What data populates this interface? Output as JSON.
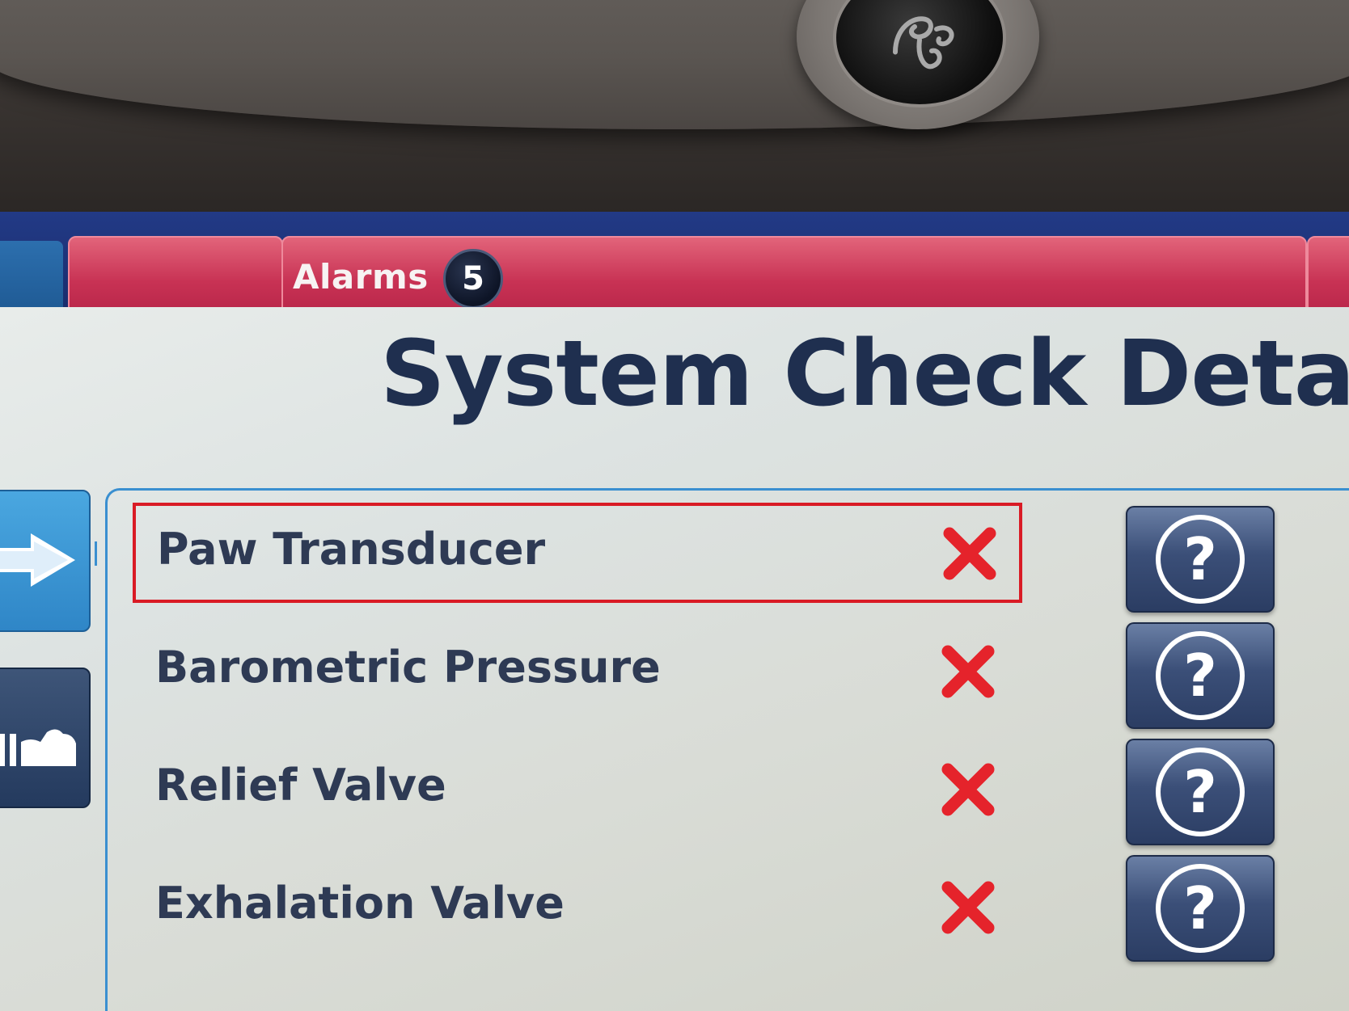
{
  "device": {
    "logo_icon": "ge-logo-icon"
  },
  "header": {
    "alarms_tab_label": "Alarms",
    "alarm_count": "5"
  },
  "main": {
    "title": "System Check Details",
    "nav_icons": [
      "arrow-right-icon",
      "ventilator-icon"
    ],
    "checks": [
      {
        "label": "Paw Transducer",
        "status_icon": "fail-x-icon",
        "selected": true,
        "help_icon": "question-mark-icon"
      },
      {
        "label": "Barometric Pressure",
        "status_icon": "fail-x-icon",
        "selected": false,
        "help_icon": "question-mark-icon"
      },
      {
        "label": "Relief Valve",
        "status_icon": "fail-x-icon",
        "selected": false,
        "help_icon": "question-mark-icon"
      },
      {
        "label": "Exhalation Valve",
        "status_icon": "fail-x-icon",
        "selected": false,
        "help_icon": "question-mark-icon"
      }
    ],
    "help_symbol": "?"
  },
  "colors": {
    "alarm_tab": "#c83254",
    "topbar": "#1b2f73",
    "fail_x": "#e5232b",
    "selection_border": "#d91b25",
    "title_text": "#1f2f4f",
    "panel_border": "#3a8fd0",
    "help_button": "#3b4f78"
  }
}
